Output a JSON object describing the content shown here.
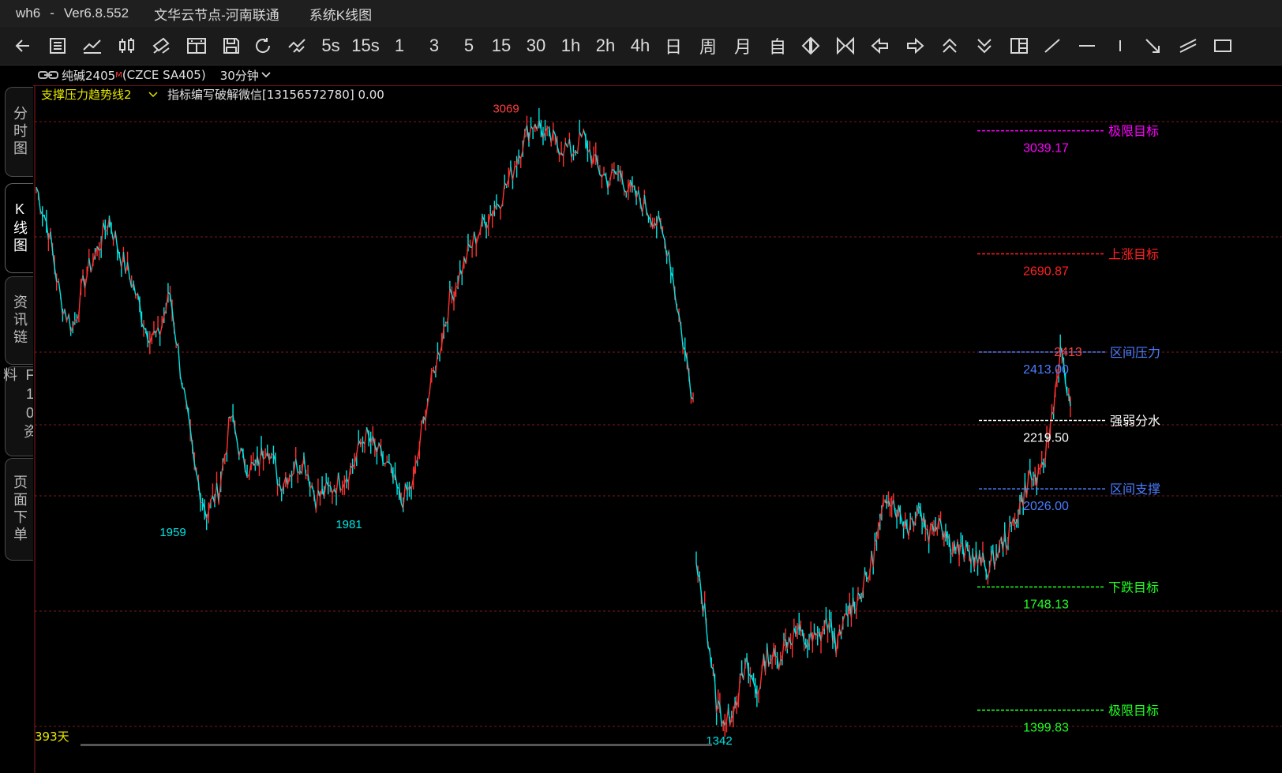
{
  "window": {
    "app": "wh6",
    "sep": "-",
    "version": "Ver6.8.552",
    "node": "文华云节点-河南联通",
    "view": "系统K线图"
  },
  "toolbar": {
    "icons": [
      "back-icon",
      "list-icon",
      "trend-icon",
      "candle-icon",
      "pen-icon",
      "layout-icon",
      "save-icon",
      "refresh-icon",
      "compare-icon"
    ],
    "periods": [
      "5s",
      "15s",
      "1",
      "3",
      "5",
      "15",
      "30",
      "1h",
      "2h",
      "4h",
      "日",
      "周",
      "月",
      "自"
    ],
    "tools": [
      "expand-icon",
      "shrink-icon",
      "scroll-left-icon",
      "scroll-right-icon",
      "zoom-in-icon",
      "zoom-out-icon",
      "split-icon",
      "line-tool-icon",
      "hline-tool-icon",
      "vline-tool-icon",
      "ray-tool-icon",
      "channel-tool-icon",
      "rect-tool-icon"
    ]
  },
  "sidetabs": [
    "分时图",
    "K线图",
    "资讯链",
    "F10资料",
    "页面下单"
  ],
  "info": {
    "symbol": "纯碱2405",
    "sup": "M",
    "code": "(CZCE SA405)",
    "period": "30分钟",
    "indicator": "支撑压力趋势线2",
    "note": "指标编写破解微信[13156572780] 0.00"
  },
  "chart_data": {
    "type": "line",
    "title": "",
    "ylim": [
      1300,
      3150
    ],
    "hlines": [
      3039.17,
      2690.87,
      2219.5,
      2026.0,
      1748.13,
      1399.83
    ],
    "labels": {
      "limit_up_name": "极限目标",
      "limit_up_value": "3039.17",
      "up_name": "上涨目标",
      "up_value": "2690.87",
      "pressure_name": "区间压力",
      "pressure_value": "2413.00",
      "pressure_tag": "2413",
      "mid_name": "强弱分水",
      "mid_value": "2219.50",
      "support_name": "区间支撑",
      "support_value": "2026.00",
      "down_name": "下跌目标",
      "down_value": "1748.13",
      "limit_down_name": "极限目标",
      "limit_down_value": "1399.83"
    },
    "extremes": [
      {
        "label": "3069",
        "value": 3069,
        "kind": "high"
      },
      {
        "label": "1959",
        "value": 1959,
        "kind": "low"
      },
      {
        "label": "1981",
        "value": 1981,
        "kind": "low"
      },
      {
        "label": "1342",
        "value": 1342,
        "kind": "low"
      }
    ],
    "days_label": "393天",
    "series": [
      {
        "values": [
          2880,
          2760,
          2560,
          2480,
          2620,
          2700,
          2790,
          2680,
          2600,
          2480,
          2450,
          2580,
          2330,
          2080,
          1960,
          2020,
          2230,
          2100,
          2080,
          2160,
          2040,
          2080,
          2110,
          2000,
          2020,
          2050,
          2090,
          2180,
          2130,
          2080,
          1990,
          2040,
          2250,
          2400,
          2560,
          2650,
          2730,
          2790,
          2840,
          2910,
          3010,
          3069,
          3020,
          3000,
          2980,
          3020,
          2940,
          2900,
          2920,
          2860,
          2830,
          2780,
          2700,
          2480,
          2280
        ]
      },
      {
        "values": [
          1800,
          1650,
          1420,
          1360,
          1440,
          1520,
          1450,
          1560,
          1540,
          1600,
          1620,
          1590,
          1600,
          1650,
          1580,
          1680,
          1720,
          1780,
          1900,
          2020,
          1960,
          1920,
          1980,
          1900,
          1950,
          1880,
          1850,
          1840,
          1820,
          1800,
          1860,
          1900,
          1980,
          2060,
          2050,
          2200,
          2413,
          2260
        ]
      }
    ]
  }
}
